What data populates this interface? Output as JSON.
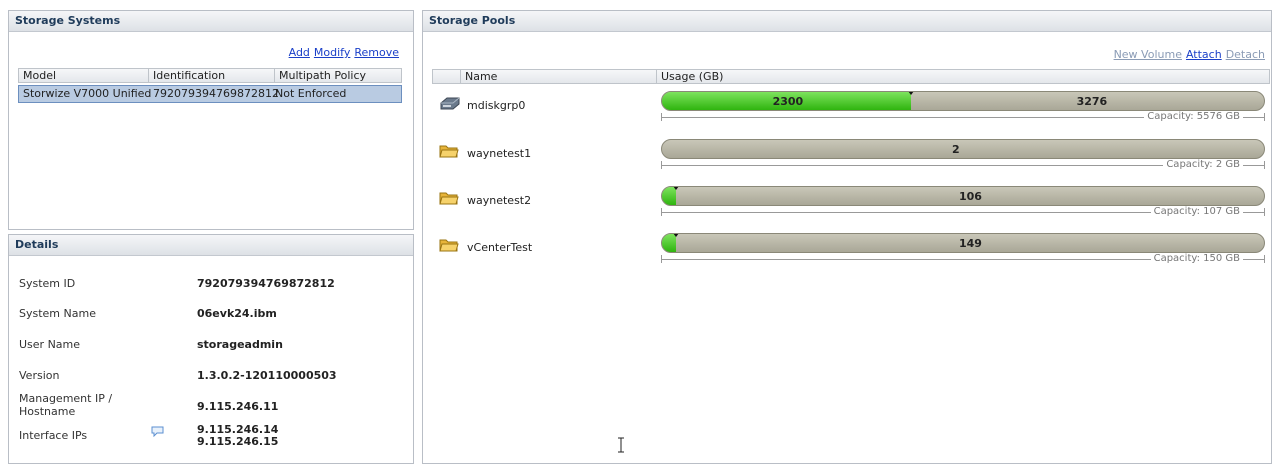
{
  "storage_systems": {
    "title": "Storage Systems",
    "actions": {
      "add": "Add",
      "modify": "Modify",
      "remove": "Remove"
    },
    "columns": [
      "Model",
      "Identification",
      "Multipath Policy"
    ],
    "rows": [
      {
        "model": "Storwize V7000 Unified",
        "identification": "792079394769872812...",
        "policy": "Not Enforced"
      }
    ]
  },
  "details": {
    "title": "Details",
    "fields": [
      {
        "label": "System ID",
        "value": "792079394769872812"
      },
      {
        "label": "System Name",
        "value": "06evk24.ibm"
      },
      {
        "label": "User Name",
        "value": "storageadmin"
      },
      {
        "label": "Version",
        "value": "1.3.0.2-120110000503"
      },
      {
        "label": "Management IP / Hostname",
        "value": "9.115.246.11"
      },
      {
        "label": "Interface IPs",
        "value": "9.115.246.14",
        "value2": "9.115.246.15"
      }
    ]
  },
  "storage_pools": {
    "title": "Storage Pools",
    "actions": {
      "new_volume": "New Volume",
      "attach": "Attach",
      "detach": "Detach"
    },
    "columns": [
      "Name",
      "Usage (GB)"
    ],
    "pools": [
      {
        "name": "mdiskgrp0",
        "icon": "disk-icon",
        "used": 2300,
        "free": 3276,
        "used_label": "2300",
        "free_label": "3276",
        "capacity": "Capacity: 5576 GB"
      },
      {
        "name": "waynetest1",
        "icon": "folder-icon",
        "used": 0,
        "free": 2,
        "used_label": "",
        "free_label": "2",
        "capacity": "Capacity: 2 GB"
      },
      {
        "name": "waynetest2",
        "icon": "folder-icon",
        "used": 1,
        "free": 106,
        "used_label": "",
        "free_label": "106",
        "capacity": "Capacity: 107 GB"
      },
      {
        "name": "vCenterTest",
        "icon": "folder-icon",
        "used": 1,
        "free": 149,
        "used_label": "",
        "free_label": "149",
        "capacity": "Capacity: 150 GB"
      }
    ]
  },
  "colors": {
    "header_text": "#1f3b5a",
    "link": "#1a3fc8",
    "used_green": "#2fb40f",
    "free_gray": "#b5b3a3",
    "selected_row": "#b9cbe2"
  }
}
